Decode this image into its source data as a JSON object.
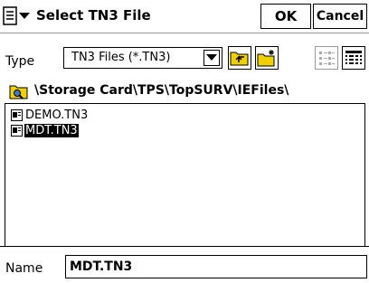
{
  "titlebar": {
    "menu_icon": "start-menu-icon",
    "title": "Select TN3 File",
    "ok_label": "OK",
    "cancel_label": "Cancel"
  },
  "type_filter": {
    "label": "Type",
    "selected": "TN3 Files (*.TN3)"
  },
  "toolbar": {
    "icons": [
      "folder-up-icon",
      "new-folder-icon",
      "list-view-icon",
      "details-view-icon"
    ]
  },
  "path": {
    "icon": "folder-search-icon",
    "text": "\\Storage Card\\TPS\\TopSURV\\IEFiles\\"
  },
  "files": [
    {
      "name": "DEMO.TN3",
      "selected": false
    },
    {
      "name": "MDT.TN3",
      "selected": true
    }
  ],
  "name_field": {
    "label": "Name",
    "value": "MDT.TN3"
  },
  "colors": {
    "folder_yellow": "#f0d000",
    "selection": "#000000",
    "border": "#000000"
  }
}
